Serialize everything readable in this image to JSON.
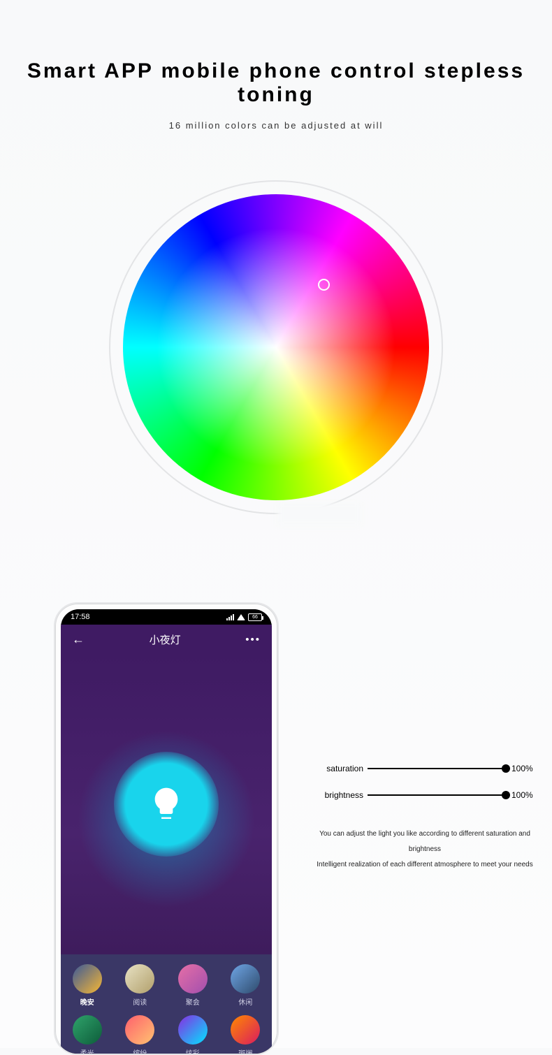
{
  "headline": "Smart APP mobile phone control stepless toning",
  "subhead": "16 million colors can be adjusted at will",
  "phone": {
    "time": "17:58",
    "battery": "66",
    "title": "小夜灯",
    "scenes_row1": [
      {
        "label": "晚安",
        "bg": "linear-gradient(135deg,#3b5998,#f7b733)"
      },
      {
        "label": "阅读",
        "bg": "linear-gradient(135deg,#e8e2c4,#b19f6b)"
      },
      {
        "label": "聚会",
        "bg": "linear-gradient(135deg,#e66fa6,#a24fae)"
      },
      {
        "label": "休闲",
        "bg": "linear-gradient(135deg,#6fa6e6,#2e4a6b)"
      }
    ],
    "scenes_row2": [
      {
        "label": "柔光",
        "bg": "linear-gradient(135deg,#2fa36b,#0d5c3a)"
      },
      {
        "label": "缤纷",
        "bg": "linear-gradient(135deg,#ff5f6d,#ffc371)"
      },
      {
        "label": "炫彩",
        "bg": "linear-gradient(135deg,#8a2be2,#00e5ff)"
      },
      {
        "label": "斑斓",
        "bg": "linear-gradient(135deg,#ff8a00,#da1b60)"
      }
    ],
    "selected_scene": 0
  },
  "sliders": {
    "saturation": {
      "label": "saturation",
      "value": "100%"
    },
    "brightness": {
      "label": "brightness",
      "value": "100%"
    }
  },
  "note_line1": "You can adjust the light you like according to different saturation and brightness",
  "note_line2": "Intelligent realization of each different atmosphere to meet your needs"
}
